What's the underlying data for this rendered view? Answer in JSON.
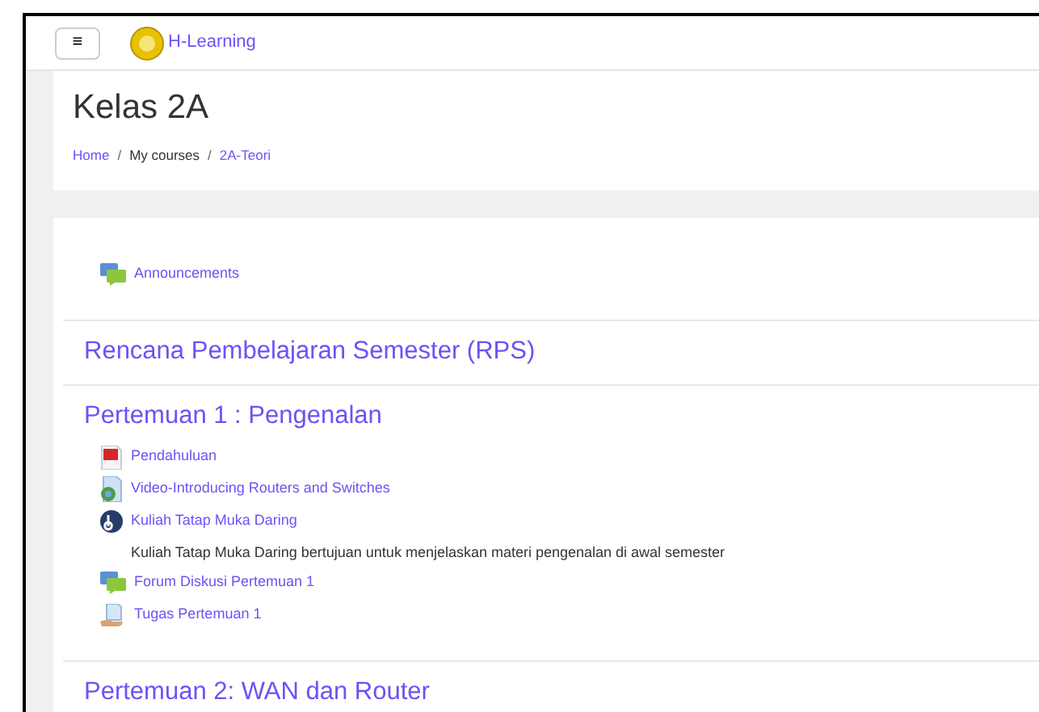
{
  "navbar": {
    "menu_icon": "≡",
    "site_name": "H-Learning"
  },
  "page_header": {
    "title": "Kelas 2A",
    "breadcrumb": [
      "Home",
      "My courses",
      "2A-Teori"
    ],
    "separator": "/"
  },
  "top_activities": [
    {
      "kind": "forum",
      "name": "Announcements"
    }
  ],
  "sections": [
    {
      "title": "Rencana Pembelajaran Semester (RPS)"
    },
    {
      "title": "Pertemuan 1 : Pengenalan",
      "activities": [
        {
          "kind": "pdf",
          "name": "Pendahuluan"
        },
        {
          "kind": "url",
          "name": "Video-Introducing Routers and Switches"
        },
        {
          "kind": "bbb",
          "name": "Kuliah Tatap Muka Daring",
          "description": "Kuliah Tatap Muka Daring bertujuan untuk menjelaskan materi pengenalan di awal semester"
        },
        {
          "kind": "forum",
          "name": "Forum Diskusi Pertemuan 1"
        },
        {
          "kind": "assign",
          "name": "Tugas Pertemuan 1"
        }
      ]
    },
    {
      "title": "Pertemuan 2: WAN dan Router"
    }
  ]
}
